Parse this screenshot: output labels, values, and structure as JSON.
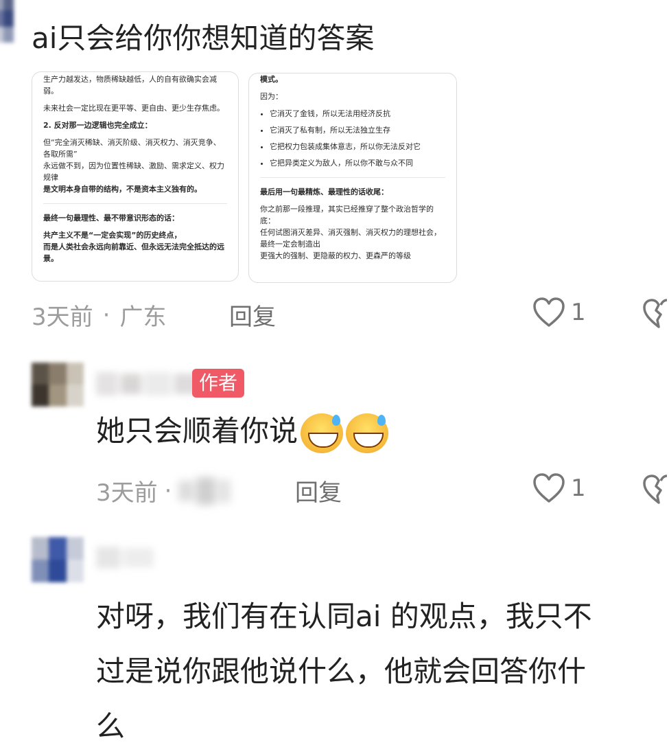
{
  "comments": [
    {
      "text": "ai只会给你你想知道的答案",
      "time": "3天前",
      "location": "广东",
      "reply_label": "回复",
      "likes": "1",
      "images": [
        {
          "blocks": [
            {
              "type": "p",
              "text": "生产力越发达，物质稀缺越低，人的自有欲确实会减弱。"
            },
            {
              "type": "p",
              "text": "未来社会一定比现在更平等、更自由、更少生存焦虑。"
            },
            {
              "type": "b",
              "text": "2. 反对那一边逻辑也完全成立："
            },
            {
              "type": "p",
              "text": "但“完全消灭稀缺、消灭阶级、消灭权力、消灭竞争、各取所需”"
            },
            {
              "type": "p",
              "text": "永远做不到，因为位置性稀缺、激励、需求定义、权力规律"
            },
            {
              "type": "b",
              "text": "是文明本身自带的结构，不是资本主义独有的。"
            },
            {
              "type": "sep"
            },
            {
              "type": "b",
              "text": "最终一句最理性、最不带意识形态的话："
            },
            {
              "type": "b",
              "text": "共产主义不是“一定会实现”的历史终点，"
            },
            {
              "type": "b",
              "text": "而是人类社会永远向前靠近、但永远无法完全抵达的远景。"
            }
          ]
        },
        {
          "blocks": [
            {
              "type": "b",
              "text": "模式。"
            },
            {
              "type": "p",
              "text": "因为："
            },
            {
              "type": "li",
              "text": "它消灭了金钱，所以无法用经济反抗"
            },
            {
              "type": "li",
              "text": "它消灭了私有制，所以无法独立生存"
            },
            {
              "type": "li",
              "text": "它把权力包装成集体意志，所以你无法反对它"
            },
            {
              "type": "li",
              "text": "它把异类定义为敌人，所以你不敢与众不同"
            },
            {
              "type": "sep"
            },
            {
              "type": "b",
              "text": "最后用一句最精炼、最理性的话收尾："
            },
            {
              "type": "b",
              "text": "你之前那一段推理，其实已经推穿了整个政治哲学的底："
            },
            {
              "type": "b",
              "text": "任何试图消灭差异、消灭强制、消灭权力的理想社会，"
            },
            {
              "type": "b",
              "text": "最终一定会制造出"
            },
            {
              "type": "b",
              "text": "更强大的强制、更隐蔽的权力、更森严的等级"
            }
          ]
        }
      ]
    },
    {
      "author_badge": "作者",
      "text": "她只会顺着你说",
      "time": "3天前",
      "reply_label": "回复",
      "likes": "1"
    },
    {
      "text_lines": [
        "对呀，我们有在认同ai 的观点，我只不",
        "过是说你跟他说什么，他就会回答你什",
        "么"
      ]
    }
  ],
  "icons": [
    "heart-icon",
    "broken-heart-icon",
    "grin-sweat-emoji"
  ]
}
